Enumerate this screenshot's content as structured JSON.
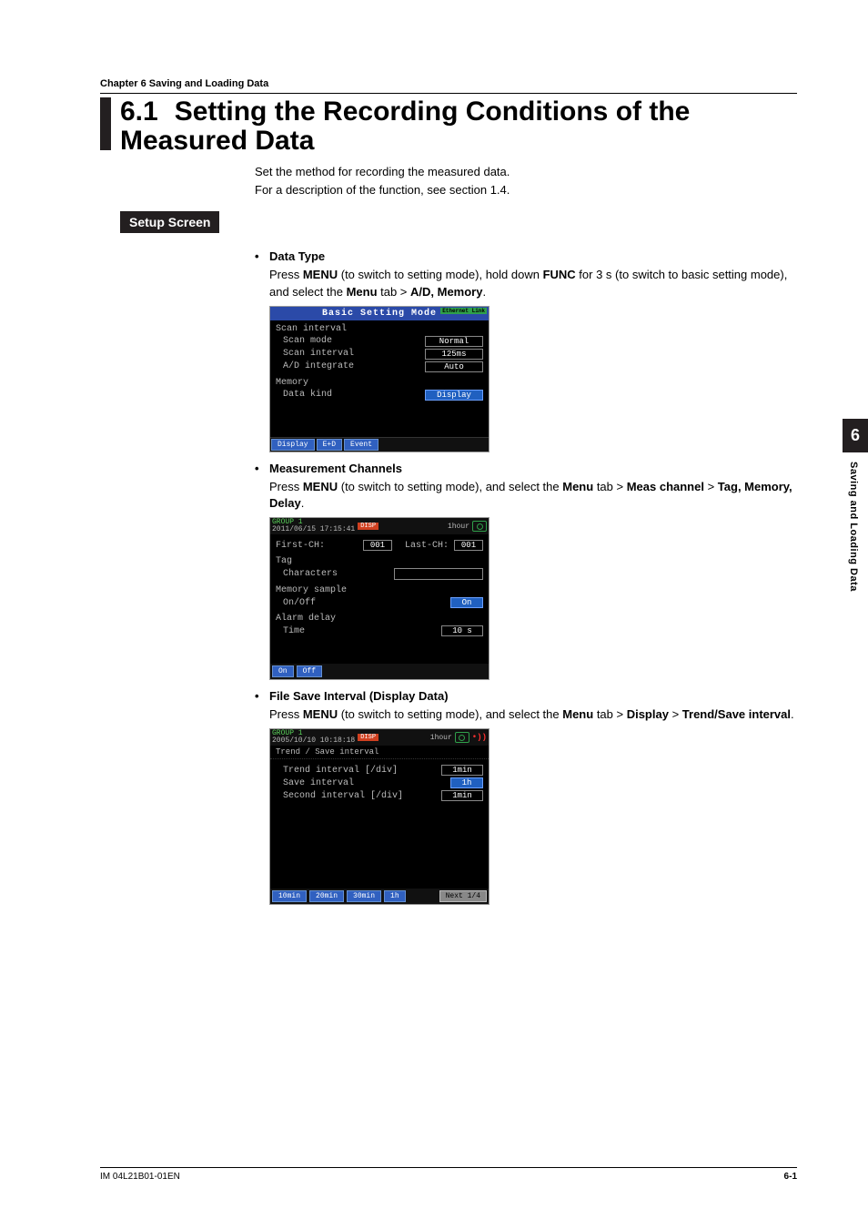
{
  "header": {
    "chapter": "Chapter 6    Saving and Loading Data"
  },
  "title": {
    "num": "6.1",
    "text": "Setting the Recording Conditions of the Measured Data"
  },
  "intro": {
    "l1": "Set the method for recording the measured data.",
    "l2": "For a description of the function, see section 1.4."
  },
  "setup_label": "Setup Screen",
  "sections": [
    {
      "title": "Data Type",
      "desc_pre": "Press ",
      "k1": "MENU",
      "desc_mid1": " (to switch to setting mode), hold down ",
      "k2": "FUNC",
      "desc_mid2": " for 3 s (to switch to basic setting mode), and select the ",
      "k3": "Menu",
      "desc_mid3": " tab > ",
      "k4": "A/D, Memory",
      "desc_end": "."
    },
    {
      "title": "Measurement Channels",
      "desc_pre": "Press ",
      "k1": "MENU",
      "desc_mid1": " (to switch to setting mode), and select the ",
      "k2": "Menu",
      "desc_mid2": " tab > ",
      "k3": "Meas channel",
      "desc_mid3": " > ",
      "k4": "Tag, Memory, Delay",
      "desc_end": "."
    },
    {
      "title": "File Save Interval (Display Data)",
      "desc_pre": "Press ",
      "k1": "MENU",
      "desc_mid1": " (to switch to setting mode), and select the ",
      "k2": "Menu",
      "desc_mid2": " tab > ",
      "k3": "Display",
      "desc_mid3": " > ",
      "k4": "Trend/Save interval",
      "desc_end": "."
    }
  ],
  "lcd1": {
    "title": "Basic Setting Mode",
    "eth": "Ethernet Link",
    "h1": "Scan interval",
    "r1l": "Scan mode",
    "r1v": "Normal",
    "r2l": "Scan interval",
    "r2v": "125ms",
    "r3l": "A/D integrate",
    "r3v": "Auto",
    "h2": "Memory",
    "r4l": "Data kind",
    "r4v": "Display",
    "sk": [
      "Display",
      "E+D",
      "Event"
    ]
  },
  "lcd2": {
    "grp": "GROUP 1",
    "ts": "2011/06/15 17:15:41",
    "disp": "DISP",
    "hour": "1hour",
    "first": "First-CH:",
    "firstv": "001",
    "last": "Last-CH:",
    "lastv": "001",
    "tag": "Tag",
    "chars": "Characters",
    "mem": "Memory sample",
    "onoff": "On/Off",
    "onoffv": "On",
    "al": "Alarm delay",
    "time": "Time",
    "timev": "10 s",
    "sk": [
      "On",
      "Off"
    ]
  },
  "lcd3": {
    "grp": "GROUP 1",
    "ts": "2005/10/10 10:18:18",
    "disp": "DISP",
    "hour": "1hour",
    "rec": "•))",
    "sub": "Trend / Save interval",
    "r1l": "Trend interval [/div]",
    "r1v": "1min",
    "r2l": "Save interval",
    "r2v": "1h",
    "r3l": "Second interval [/div]",
    "r3v": "1min",
    "sk": [
      "10min",
      "20min",
      "30min",
      "1h"
    ],
    "next": "Next 1/4"
  },
  "side": {
    "num": "6",
    "label": "Saving and Loading Data"
  },
  "footer": {
    "doc": "IM 04L21B01-01EN",
    "page": "6-1"
  }
}
